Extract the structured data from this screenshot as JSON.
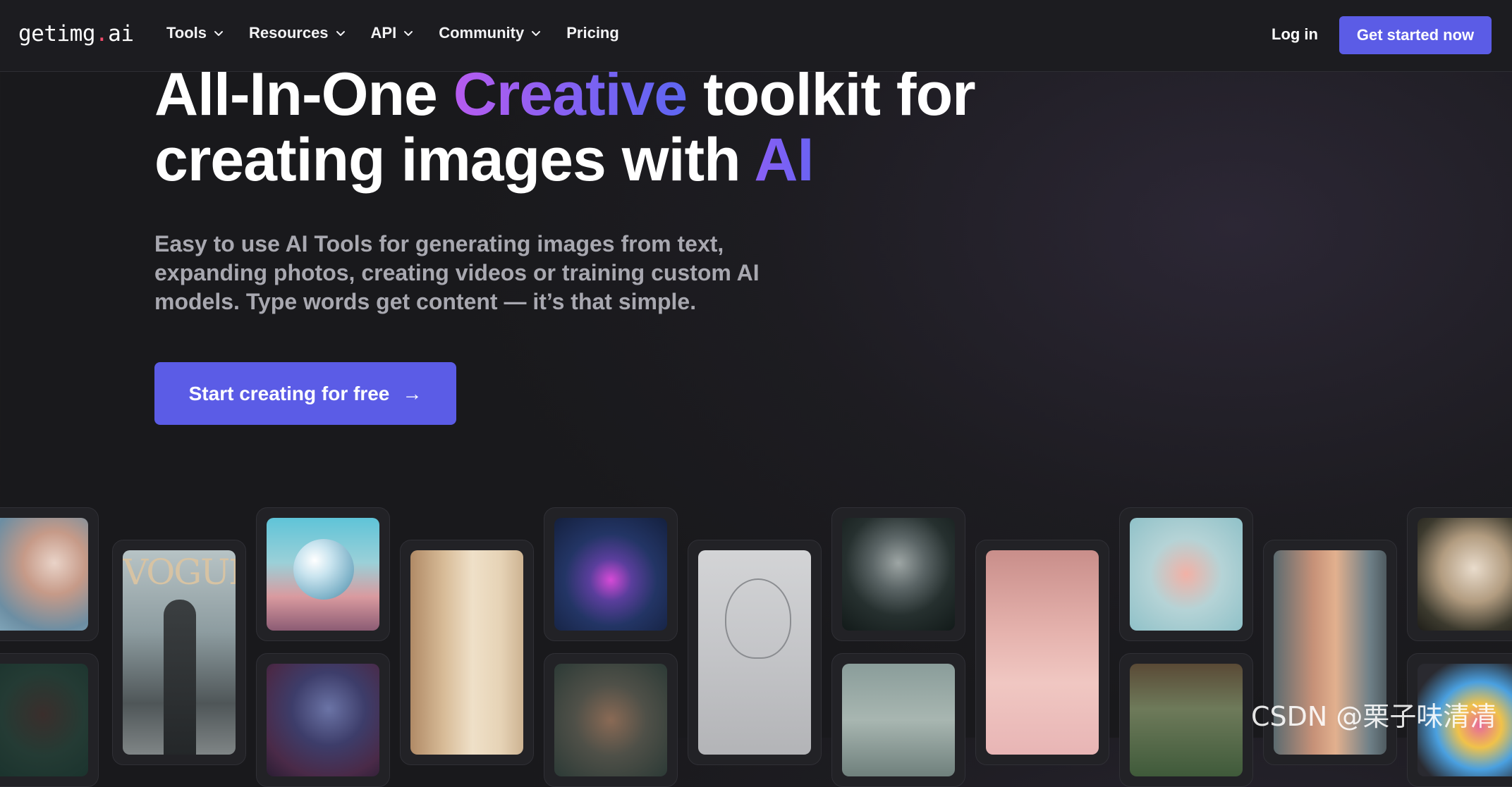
{
  "header": {
    "logo_main": "getimg",
    "logo_dot": ".",
    "logo_tld": "ai",
    "nav": [
      {
        "label": "Tools",
        "has_dropdown": true
      },
      {
        "label": "Resources",
        "has_dropdown": true
      },
      {
        "label": "API",
        "has_dropdown": true
      },
      {
        "label": "Community",
        "has_dropdown": true
      },
      {
        "label": "Pricing",
        "has_dropdown": false
      }
    ],
    "login_label": "Log in",
    "cta_label": "Get started now"
  },
  "hero": {
    "title_part1": "All-In-One ",
    "title_highlight": "Creative",
    "title_part2": " toolkit for creating images with ",
    "title_ai": "AI",
    "subtitle": "Easy to use AI Tools for generating images from text, expanding photos, creating videos or training custom AI models. Type words get content — it’s that simple.",
    "cta_label": "Start creating for free",
    "cta_icon": "arrow-right-icon"
  },
  "gallery": {
    "vogue_text": "VOGUE",
    "images": [
      "woman-profile-portrait",
      "dark-figure-portrait",
      "vogue-statue-cover",
      "glass-sphere-landscape",
      "cyberpunk-figure",
      "minimal-bedroom",
      "neon-robot-heart",
      "woman-face-closeup",
      "wireframe-head-sketch",
      "pale-alien-bust",
      "misty-figure",
      "pink-teddy-room",
      "glass-runner-figure",
      "greenhouse-interior",
      "astronaut-doorway",
      "marble-statue-bust",
      "colorful-balloons"
    ]
  },
  "watermark": "CSDN @栗子味清清",
  "colors": {
    "accent": "#5b5ce6",
    "background": "#1c1c20",
    "logo_dot": "#f14b6b",
    "highlight_gradient_start": "#b75cf0",
    "highlight_gradient_end": "#5e66f2"
  }
}
